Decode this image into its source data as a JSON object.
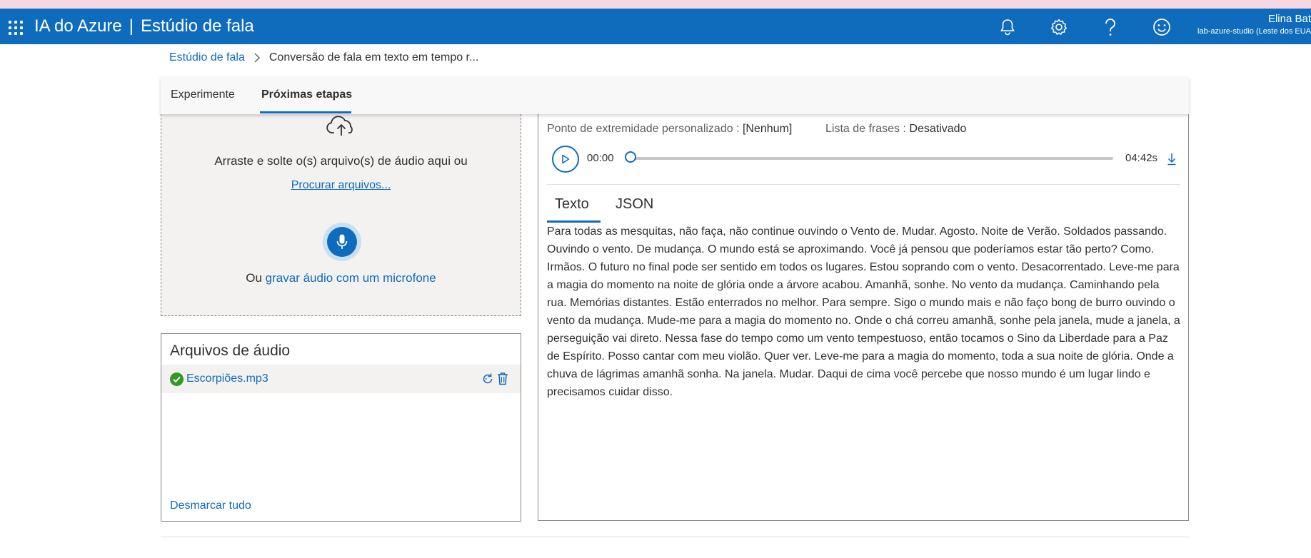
{
  "header": {
    "app_name": "IA do Azure",
    "separator": "|",
    "product": "Estúdio de fala",
    "icons": [
      "bell-icon",
      "gear-icon",
      "help-icon",
      "feedback-smiley-icon"
    ],
    "user_name": "Elina Bat",
    "user_tenant": "lab-azure-studio (Leste dos EUA"
  },
  "breadcrumb": {
    "root": "Estúdio de fala",
    "current": "Conversão de fala em texto em tempo r..."
  },
  "tabs": [
    {
      "label": "Experimente",
      "active": false
    },
    {
      "label": "Próximas etapas",
      "active": true
    }
  ],
  "upload": {
    "drop_hint": "Arraste e solte o(s) arquivo(s) de áudio aqui ou",
    "browse_link": "Procurar arquivos...",
    "record_prefix": "Ou ",
    "record_link": "gravar áudio com um microfone"
  },
  "audio_files": {
    "title": "Arquivos de áudio",
    "files": [
      {
        "name": "Escorpiões.mp3",
        "status": "success"
      }
    ],
    "unselect_all": "Desmarcar tudo"
  },
  "settings": {
    "endpoint_label": "Ponto de extremidade personalizado :",
    "endpoint_value": "[Nenhum]",
    "phrase_list_label": "Lista de frases :",
    "phrase_list_value": "Desativado"
  },
  "player": {
    "current_time": "00:00",
    "duration": "04:42s",
    "progress": 0
  },
  "result_tabs": [
    {
      "label": "Texto",
      "active": true
    },
    {
      "label": "JSON",
      "active": false
    }
  ],
  "transcript": "Para todas as mesquitas, não faça, não continue ouvindo o Vento de. Mudar. Agosto. Noite de Verão. Soldados passando. Ouvindo o vento. De mudança. O mundo está se aproximando. Você já pensou que poderíamos estar tão perto? Como. Irmãos. O futuro no final pode ser sentido em todos os lugares. Estou soprando com o vento. Desacorrentado. Leve-me para a magia do momento na noite de glória onde a árvore acabou. Amanhã, sonhe. No vento da mudança. Caminhando pela rua. Memórias distantes. Estão enterrados no melhor. Para sempre. Sigo o mundo mais e não faço bong de burro ouvindo o vento da mudança. Mude-me para a magia do momento no. Onde o chá correu amanhã, sonhe pela janela, mude a janela, a perseguição vai direto. Nessa fase do tempo como um vento tempestuoso, então tocamos o Sino da Liberdade para a Paz de Espírito. Posso cantar com meu violão. Quer ver. Leve-me para a magia do momento, toda a sua noite de glória. Onde a chuva de lágrimas amanhã sonha. Na janela. Mudar. Daqui de cima você percebe que nosso mundo é um lugar lindo e precisamos cuidar disso."
}
